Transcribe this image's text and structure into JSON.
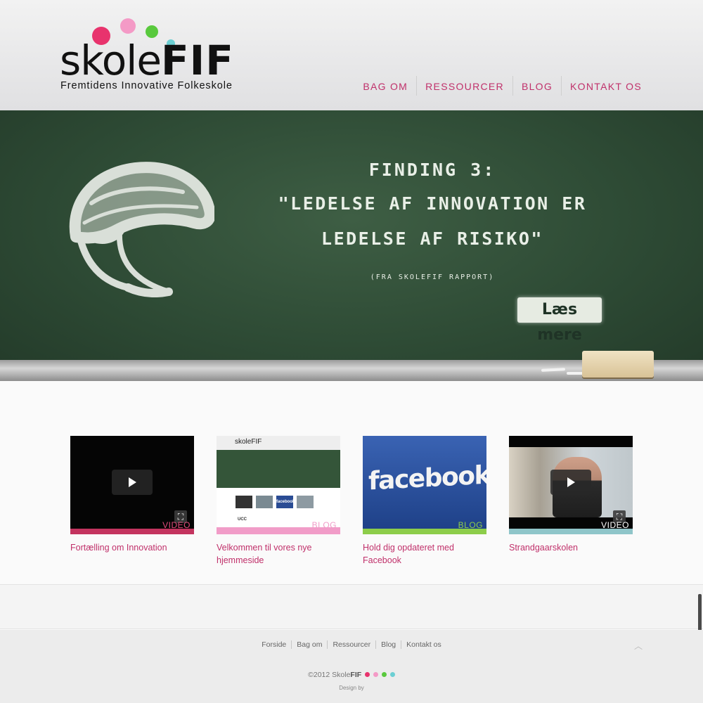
{
  "brand": {
    "name_thin": "skole",
    "name_bold": "FIF",
    "tagline": "Fremtidens Innovative Folkeskole",
    "dot_colors": [
      "#e8336d",
      "#f49ac6",
      "#59c93d",
      "#6ccfd3"
    ]
  },
  "nav": [
    "BAG OM",
    "RESSOURCER",
    "BLOG",
    "KONTAKT OS"
  ],
  "hero": {
    "line1": "FINDING 3:",
    "line2": "\"LEDELSE AF INNOVATION ER",
    "line3": "LEDELSE AF RISIKO\"",
    "source": "(FRA SKOLEFIF RAPPORT)",
    "button": "Læs mere"
  },
  "cards": [
    {
      "tag": "VIDEO",
      "title": "Fortælling om Innovation",
      "bar_color": "#c3345f",
      "tag_color": "#e24a7b"
    },
    {
      "tag": "BLOG",
      "title": "Velkommen til vores nye hjemmeside",
      "bar_color": "#f19cc8",
      "tag_color": "#f19cc8"
    },
    {
      "tag": "BLOG",
      "title": "Hold dig opdateret med Facebook",
      "bar_color": "#8dcd4a",
      "tag_color": "#8dcd4a"
    },
    {
      "tag": "VIDEO",
      "title": "Strandgaarskolen",
      "bar_color": "#8fc5c9",
      "tag_color": "#ffffff"
    }
  ],
  "blog_thumb": {
    "logo": "skoleFIF",
    "badge1": "UCC",
    "badge2": "facebook"
  },
  "facebook_thumb": {
    "word": "facebook"
  },
  "footer": {
    "links": [
      "Forside",
      "Bag om",
      "Ressourcer",
      "Blog",
      "Kontakt os"
    ],
    "copyright_prefix": "©2012 Skole",
    "copyright_bold": "FIF",
    "design_by": "Design by"
  }
}
